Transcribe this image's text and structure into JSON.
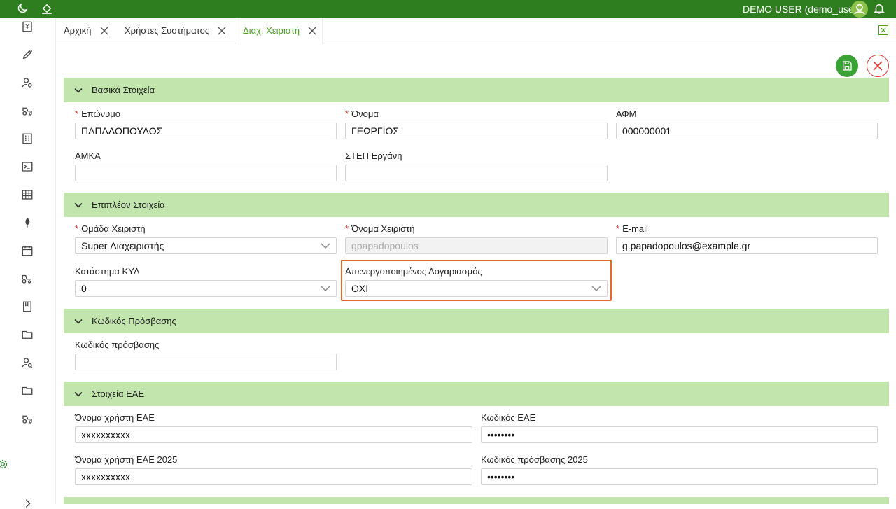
{
  "topbar": {
    "user_label": "DEMO USER (demo_user)",
    "icons": [
      "moon-icon",
      "theme-icon",
      "avatar-icon",
      "bell-icon"
    ]
  },
  "sidebar": {
    "icons": [
      "currency-box-icon",
      "syringe-icon",
      "user-search-icon",
      "tractor-icon",
      "building-icon",
      "terminal-icon",
      "table-grid-icon",
      "leaf-icon",
      "calendar-icon",
      "tractor-trailer-icon",
      "book-icon",
      "folder-icon",
      "user-group-search-icon",
      "folder-icon",
      "tractor-icon",
      "gear-icon",
      "expand-icon"
    ]
  },
  "tabs": [
    {
      "label": "Αρχική",
      "active": false
    },
    {
      "label": "Χρήστες Συστήματος",
      "active": false
    },
    {
      "label": "Διαχ. Χειριστή",
      "active": true
    }
  ],
  "colors": {
    "brand_green": "#2e7d1f",
    "section_bg": "#c1e5ad",
    "accent_green": "#3aa335",
    "danger_red": "#e53935",
    "highlight_orange": "#e0692c"
  },
  "sections": {
    "basic": {
      "title": "Βασικά Στοιχεία",
      "surname_label": "Επώνυμο",
      "surname_value": "ΠΑΠΑΔΟΠΟΥΛΟΣ",
      "name_label": "Όνομα",
      "name_value": "ΓΕΩΡΓΙΟΣ",
      "afm_label": "ΑΦΜ",
      "afm_value": "000000001",
      "amka_label": "ΑΜΚΑ",
      "amka_value": "",
      "step_label": "ΣΤΕΠ Εργάνη",
      "step_value": ""
    },
    "extra": {
      "title": "Επιπλέον Στοιχεία",
      "group_label": "Ομάδα Χειριστή",
      "group_value": "Super Διαχειριστής",
      "username_label": "Όνομα Χειριστή",
      "username_placeholder": "gpapadopoulos",
      "email_label": "E-mail",
      "email_value": "g.papadopoulos@example.gr",
      "store_label": "Κατάστημα ΚΥΔ",
      "store_value": "0",
      "disabled_label": "Απενεργοποιημένος Λογαριασμός",
      "disabled_value": "ΟΧΙ"
    },
    "password": {
      "title": "Κωδικός Πρόσβασης",
      "password_label": "Κωδικός πρόσβασης",
      "password_value": ""
    },
    "eae": {
      "title": "Στοιχεία ΕΑΕ",
      "user_label": "Όνομα χρήστη ΕΑΕ",
      "user_value": "xxxxxxxxxx",
      "code_label": "Κωδικός ΕΑΕ",
      "code_value": "••••••••",
      "user2025_label": "Όνομα χρήστη ΕΑΕ 2025",
      "user2025_value": "xxxxxxxxxx",
      "code2025_label": "Κωδικός πρόσβασης 2025",
      "code2025_value": "••••••••"
    }
  }
}
